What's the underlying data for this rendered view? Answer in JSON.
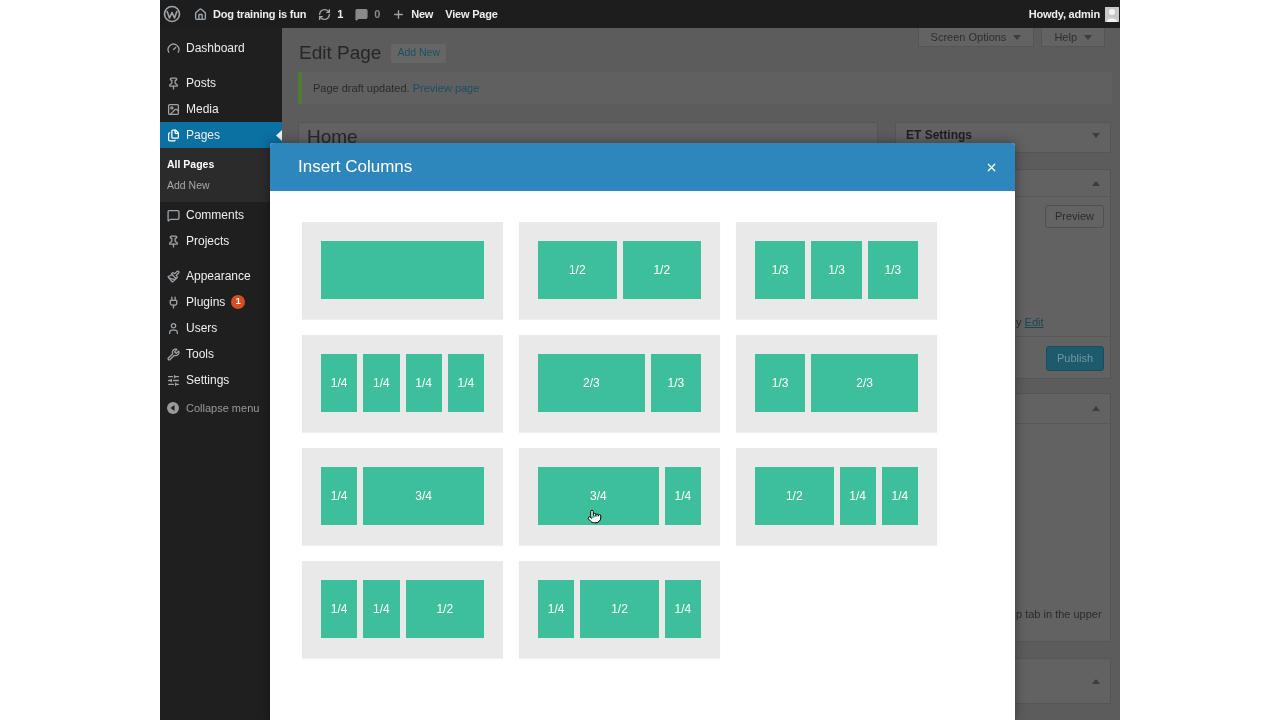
{
  "admin_bar": {
    "items": [
      {
        "kind": "site",
        "label": "Dog training is fun"
      },
      {
        "kind": "updates",
        "label": "1"
      },
      {
        "kind": "comments",
        "label": "0"
      },
      {
        "kind": "new",
        "label": "New"
      },
      {
        "kind": "link",
        "label": "View Page"
      }
    ],
    "account": "Howdy, admin"
  },
  "sidebar": {
    "groups": [
      {
        "items": [
          {
            "label": "Dashboard",
            "selected": false
          }
        ]
      },
      {
        "items": [
          {
            "label": "Posts",
            "selected": false
          },
          {
            "label": "Media",
            "selected": false
          },
          {
            "label": "Pages",
            "selected": true,
            "children": [
              {
                "label": "All Pages",
                "selected": true
              },
              {
                "label": "Add New",
                "selected": false
              }
            ]
          },
          {
            "label": "Comments",
            "selected": false
          },
          {
            "label": "Projects",
            "selected": false
          }
        ]
      },
      {
        "items": [
          {
            "label": "Appearance",
            "selected": false
          },
          {
            "label": "Plugins",
            "selected": false,
            "badge": "1"
          },
          {
            "label": "Users",
            "selected": false
          },
          {
            "label": "Tools",
            "selected": false
          },
          {
            "label": "Settings",
            "selected": false
          }
        ]
      }
    ],
    "collapse": "Collapse menu"
  },
  "page": {
    "heading": "Edit Page",
    "add_new": "Add New",
    "screen_tabs": [
      "Screen Options",
      "Help"
    ],
    "notice": {
      "text": "Page draft updated.",
      "link": "Preview page"
    },
    "title_field": {
      "value": "Home"
    },
    "side_boxes": [
      {
        "title": "ET Settings",
        "expanded": false
      },
      {
        "expanded": true,
        "preview_button": "Preview",
        "status_line": {
          "text": "y",
          "link": "Edit"
        },
        "publish_button": "Publish"
      },
      {
        "expanded": true,
        "text": "p tab in the upper"
      },
      {
        "expanded": true
      }
    ]
  },
  "modal": {
    "title": "Insert Columns",
    "layouts": [
      {
        "columns": [
          {
            "kind": "full"
          }
        ]
      },
      {
        "columns": [
          {
            "kind": "half",
            "label": "1/2"
          },
          {
            "kind": "half",
            "label": "1/2"
          }
        ]
      },
      {
        "columns": [
          {
            "kind": "third",
            "label": "1/3"
          },
          {
            "kind": "third",
            "label": "1/3"
          },
          {
            "kind": "third",
            "label": "1/3"
          }
        ]
      },
      {
        "columns": [
          {
            "kind": "quarter",
            "label": "1/4"
          },
          {
            "kind": "quarter",
            "label": "1/4"
          },
          {
            "kind": "quarter",
            "label": "1/4"
          },
          {
            "kind": "quarter",
            "label": "1/4"
          }
        ]
      },
      {
        "columns": [
          {
            "kind": "two_thirds",
            "label": "2/3"
          },
          {
            "kind": "third",
            "label": "1/3"
          }
        ]
      },
      {
        "columns": [
          {
            "kind": "third",
            "label": "1/3"
          },
          {
            "kind": "two_thirds",
            "label": "2/3"
          }
        ]
      },
      {
        "columns": [
          {
            "kind": "quarter",
            "label": "1/4"
          },
          {
            "kind": "three_quarters",
            "label": "3/4"
          }
        ]
      },
      {
        "columns": [
          {
            "kind": "three_quarters",
            "label": "3/4"
          },
          {
            "kind": "quarter",
            "label": "1/4"
          }
        ]
      },
      {
        "columns": [
          {
            "kind": "half",
            "label": "1/2"
          },
          {
            "kind": "quarter",
            "label": "1/4"
          },
          {
            "kind": "quarter",
            "label": "1/4"
          }
        ]
      },
      {
        "columns": [
          {
            "kind": "quarter",
            "label": "1/4"
          },
          {
            "kind": "quarter",
            "label": "1/4"
          },
          {
            "kind": "half",
            "label": "1/2"
          }
        ]
      },
      {
        "columns": [
          {
            "kind": "quarter",
            "label": "1/4"
          },
          {
            "kind": "half",
            "label": "1/2"
          },
          {
            "kind": "quarter",
            "label": "1/4"
          }
        ]
      }
    ]
  }
}
